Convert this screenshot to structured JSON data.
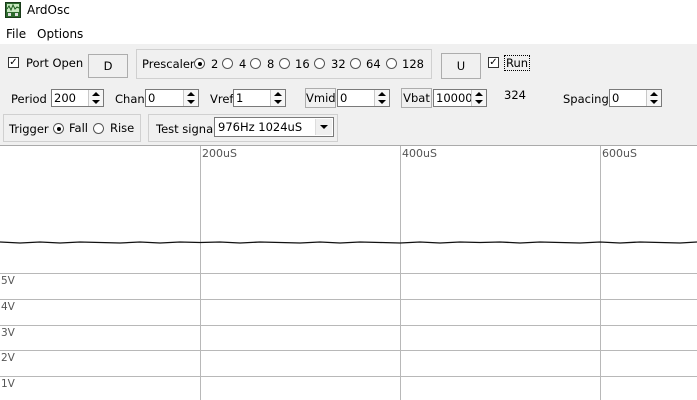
{
  "window": {
    "title": "ArdOsc",
    "icon": "oscilloscope-app-icon"
  },
  "menu": {
    "items": [
      "File",
      "Options"
    ]
  },
  "controls": {
    "port_open": {
      "label": "Port Open",
      "checked": true
    },
    "d_button": "D",
    "prescaler": {
      "label": "Prescaler",
      "options": [
        "2",
        "4",
        "8",
        "16",
        "32",
        "64",
        "128"
      ],
      "selected": "2"
    },
    "u_button": "U",
    "run": {
      "label": "Run",
      "checked": true
    },
    "period": {
      "label": "Period",
      "value": "200"
    },
    "chan": {
      "label": "Chan",
      "value": "0"
    },
    "vref": {
      "label": "Vref",
      "value": "1"
    },
    "vmid": {
      "label": "Vmid",
      "value": "0"
    },
    "vbat": {
      "label": "Vbat",
      "value": "10000"
    },
    "count": "324",
    "spacing": {
      "label": "Spacing",
      "value": "0"
    },
    "trigger": {
      "label": "Trigger",
      "options": [
        "Fall",
        "Rise"
      ],
      "selected": "Fall"
    },
    "test_signal": {
      "label": "Test signal",
      "value": "976Hz 1024uS"
    }
  },
  "scope": {
    "time_labels": [
      "200uS",
      "400uS",
      "600uS"
    ],
    "volt_labels": [
      "5V",
      "4V",
      "3V",
      "2V",
      "1V"
    ],
    "signal_level": "flat"
  }
}
